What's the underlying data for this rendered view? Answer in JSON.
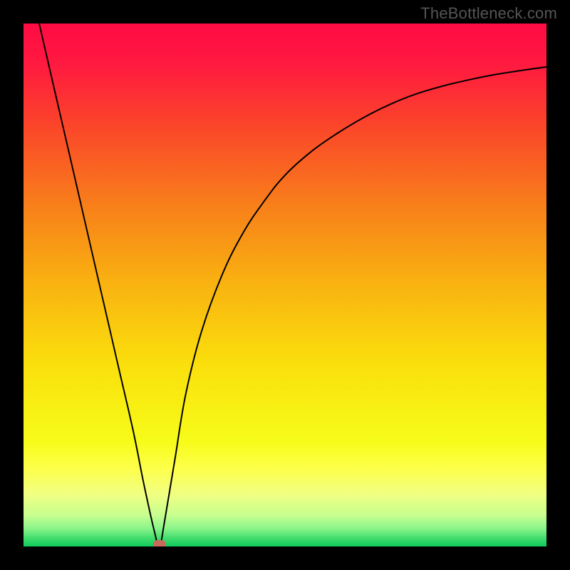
{
  "watermark": "TheBottleneck.com",
  "chart_data": {
    "type": "line",
    "title": "",
    "xlabel": "",
    "ylabel": "",
    "xlim": [
      0,
      100
    ],
    "ylim": [
      0,
      100
    ],
    "background": {
      "type": "vertical-gradient",
      "stops": [
        {
          "pos": 0.0,
          "color": "#ff0b45"
        },
        {
          "pos": 0.08,
          "color": "#ff1a3f"
        },
        {
          "pos": 0.2,
          "color": "#fb4729"
        },
        {
          "pos": 0.35,
          "color": "#f8801a"
        },
        {
          "pos": 0.5,
          "color": "#f9b310"
        },
        {
          "pos": 0.65,
          "color": "#fadf0c"
        },
        {
          "pos": 0.8,
          "color": "#f7fc19"
        },
        {
          "pos": 0.85,
          "color": "#fdff4a"
        },
        {
          "pos": 0.9,
          "color": "#f1ff82"
        },
        {
          "pos": 0.94,
          "color": "#c7ff8f"
        },
        {
          "pos": 0.965,
          "color": "#8cf58b"
        },
        {
          "pos": 0.985,
          "color": "#3edc6b"
        },
        {
          "pos": 1.0,
          "color": "#0fc95c"
        }
      ]
    },
    "series": [
      {
        "name": "bottleneck-curve",
        "x": [
          3,
          6,
          9,
          12,
          15,
          18,
          21,
          23,
          25,
          26,
          27,
          29,
          31,
          34,
          38,
          42,
          46,
          50,
          55,
          60,
          65,
          70,
          75,
          80,
          85,
          90,
          95,
          100
        ],
        "y": [
          100,
          87,
          74,
          61,
          48,
          35,
          22,
          12,
          3,
          0,
          5,
          17,
          29,
          41,
          52,
          60,
          66,
          71,
          75.5,
          79,
          82,
          84.5,
          86.5,
          88,
          89.2,
          90.2,
          91,
          91.7
        ]
      }
    ],
    "marker": {
      "x": 26,
      "y": 0,
      "color": "#c86a5c"
    }
  }
}
